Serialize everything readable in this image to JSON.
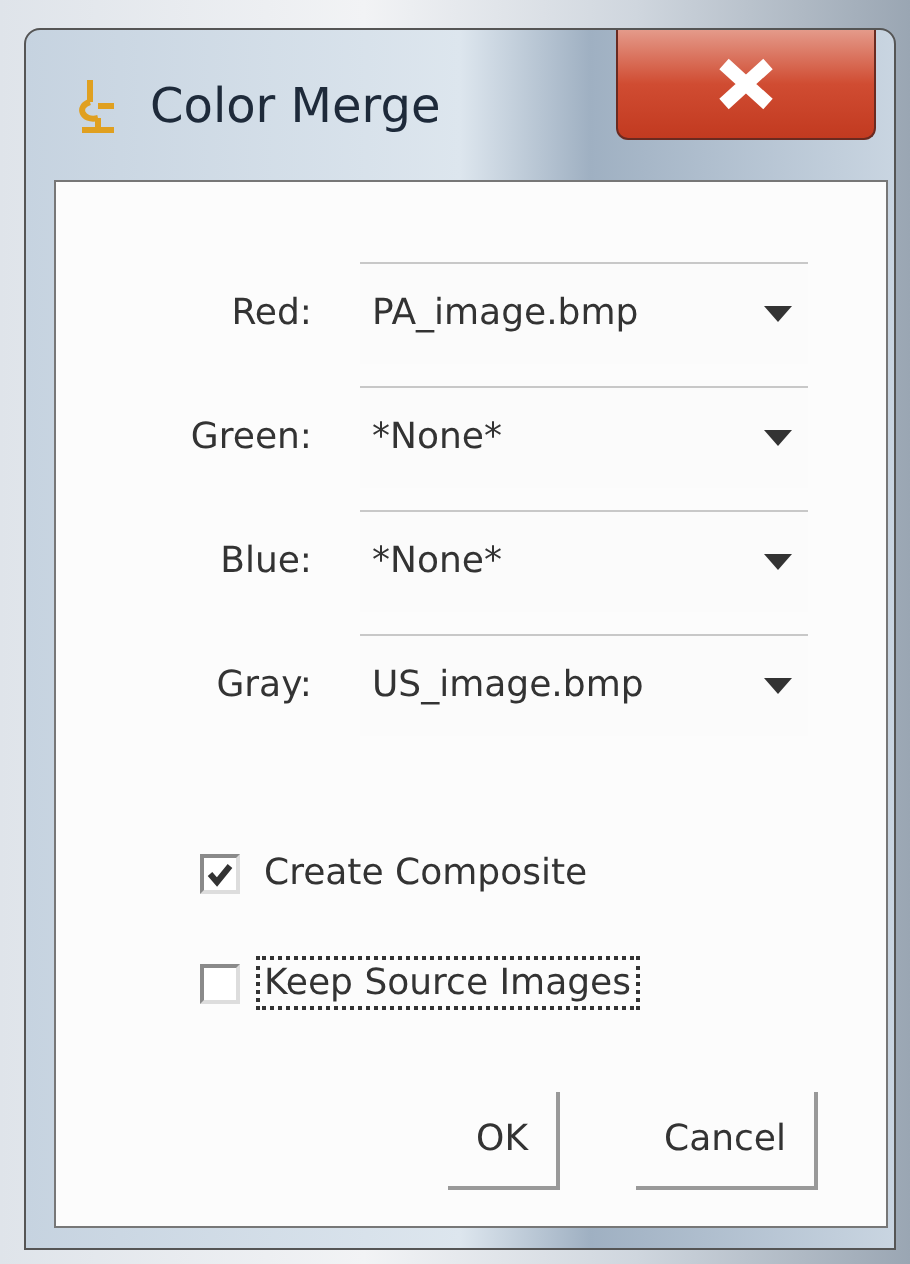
{
  "window": {
    "title": "Color Merge"
  },
  "channels": [
    {
      "label": "Red:",
      "value": "PA_image.bmp"
    },
    {
      "label": "Green:",
      "value": "*None*"
    },
    {
      "label": "Blue:",
      "value": "*None*"
    },
    {
      "label": "Gray:",
      "value": "US_image.bmp"
    }
  ],
  "options": [
    {
      "label": "Create Composite",
      "checked": true,
      "focused": false
    },
    {
      "label": "Keep Source Images",
      "checked": false,
      "focused": true
    }
  ],
  "buttons": [
    "OK",
    "Cancel"
  ]
}
